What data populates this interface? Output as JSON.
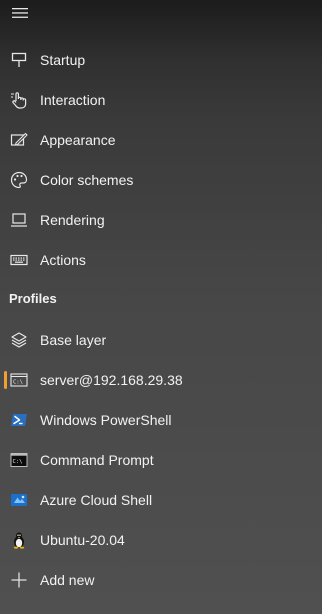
{
  "nav": {
    "menu_icon": "hamburger-icon",
    "items": [
      {
        "label": "Startup",
        "icon": "startup-icon"
      },
      {
        "label": "Interaction",
        "icon": "hand-pointer-icon"
      },
      {
        "label": "Appearance",
        "icon": "pen-window-icon"
      },
      {
        "label": "Color schemes",
        "icon": "palette-icon"
      },
      {
        "label": "Rendering",
        "icon": "monitor-icon"
      },
      {
        "label": "Actions",
        "icon": "keyboard-icon"
      }
    ],
    "profiles_header": "Profiles",
    "profiles": [
      {
        "label": "Base layer",
        "icon": "layers-icon"
      },
      {
        "label": "server@192.168.29.38",
        "icon": "terminal-window-icon",
        "selected": true
      },
      {
        "label": "Windows PowerShell",
        "icon": "powershell-icon"
      },
      {
        "label": "Command Prompt",
        "icon": "cmd-icon"
      },
      {
        "label": "Azure Cloud Shell",
        "icon": "azure-cloud-shell-icon"
      },
      {
        "label": "Ubuntu-20.04",
        "icon": "tux-icon"
      }
    ],
    "add_new": {
      "label": "Add new",
      "icon": "plus-icon"
    },
    "accent_color": "#f0a030"
  }
}
